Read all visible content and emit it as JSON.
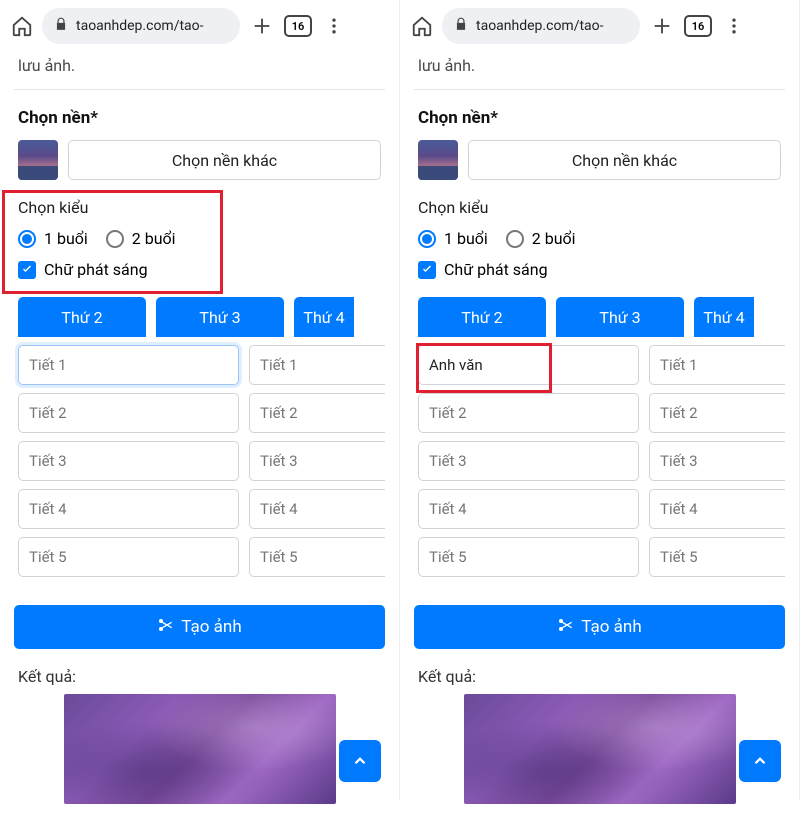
{
  "browser": {
    "url": "taoanhdep.com/tao-",
    "tab_count": "16"
  },
  "faded_header": "lưu ảnh.",
  "background": {
    "label": "Chọn nền*",
    "button": "Chọn nền khác"
  },
  "style": {
    "label": "Chọn kiểu",
    "opt1": "1 buổi",
    "opt2": "2 buổi",
    "glow": "Chữ phát sáng"
  },
  "days": {
    "d1": "Thứ 2",
    "d2": "Thứ 3",
    "d3": "Thứ 4"
  },
  "periods": {
    "p1": "Tiết 1",
    "p2": "Tiết 2",
    "p3": "Tiết 3",
    "p4": "Tiết 4",
    "p5": "Tiết 5"
  },
  "right_panel": {
    "first_cell_value": "Anh văn"
  },
  "create_button": "Tạo ảnh",
  "result_label": "Kết quả:"
}
